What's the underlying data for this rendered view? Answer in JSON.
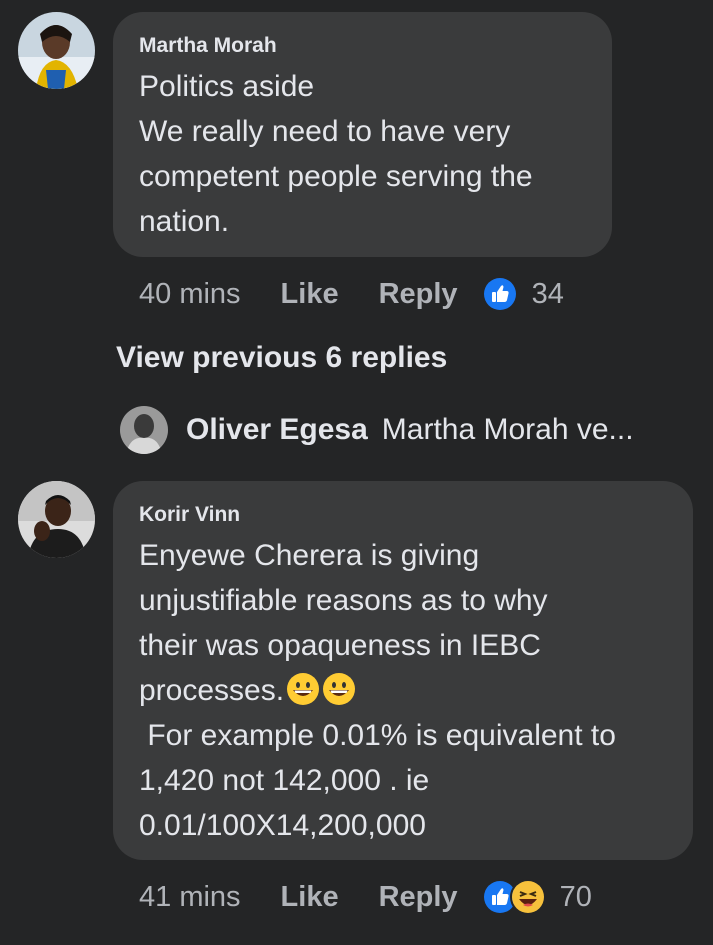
{
  "comments": [
    {
      "author": "Martha Morah",
      "text": "Politics aside\nWe really need to have very\ncompetent people serving the\nnation.",
      "time": "40 mins",
      "like_label": "Like",
      "reply_label": "Reply",
      "reactions": [
        "like-icon"
      ],
      "reaction_count": "34"
    },
    {
      "author": "Korir Vinn",
      "text_line1": "Enyewe Cherera is giving\nunjustifiable reasons as to why\ntheir was opaqueness in IEBC\nprocesses.",
      "text_emojis": [
        "grinning-face-emoji",
        "grinning-face-emoji"
      ],
      "text_line2": " For example 0.01% is equivalent to\n1,420 not 142,000 . ie\n0.01/100X14,200,000",
      "time": "41 mins",
      "like_label": "Like",
      "reply_label": "Reply",
      "reactions": [
        "like-icon",
        "haha-icon"
      ],
      "reaction_count": "70"
    }
  ],
  "view_previous_label": "View previous 6 replies",
  "reply_preview": {
    "author": "Oliver Egesa",
    "text": "Martha Morah ve..."
  },
  "colors": {
    "background": "#242526",
    "bubble": "#3a3b3c",
    "primary_text": "#e4e6eb",
    "secondary_text": "#b0b3b8",
    "like_blue": "#1877f2"
  }
}
